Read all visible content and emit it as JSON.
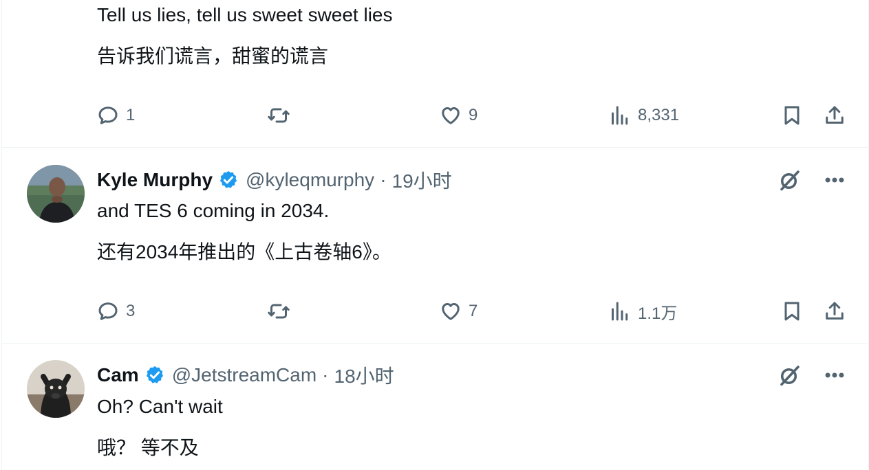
{
  "tweets": [
    {
      "text_en": "Tell us lies, tell us sweet sweet lies",
      "text_zh": "告诉我们谎言，甜蜜的谎言",
      "actions": {
        "replies": "1",
        "retweets": "",
        "likes": "9",
        "views": "8,331"
      }
    },
    {
      "name": "Kyle Murphy",
      "handle": "@kyleqmurphy",
      "separator": "·",
      "time": "19小时",
      "text_en": "and TES 6 coming in 2034.",
      "text_zh": "还有2034年推出的《上古卷轴6》。",
      "actions": {
        "replies": "3",
        "retweets": "",
        "likes": "7",
        "views": "1.1万"
      }
    },
    {
      "name": "Cam",
      "handle": "@JetstreamCam",
      "separator": "·",
      "time": "18小时",
      "text_en": "Oh? Can't wait",
      "text_zh": "哦？ 等不及"
    }
  ],
  "icons": {
    "reply": "reply-icon",
    "retweet": "retweet-icon",
    "like": "heart-icon",
    "views": "views-icon",
    "bookmark": "bookmark-icon",
    "share": "share-icon",
    "verified": "verified-badge-icon",
    "grok": "grok-icon",
    "more": "more-icon"
  },
  "colors": {
    "verified": "#1d9bf0",
    "text": "#0f1419",
    "secondary": "#536471",
    "divider": "#eff3f4"
  }
}
